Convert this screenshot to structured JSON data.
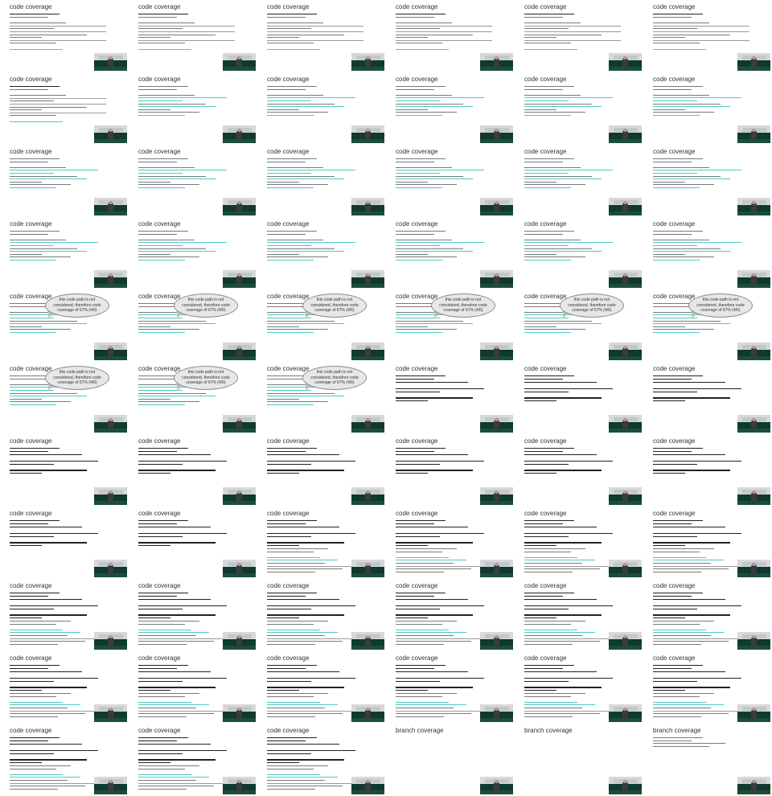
{
  "sheet": {
    "columns": 6,
    "rows": 11,
    "frame_count": 63
  },
  "bubble_text": "this code path is not considered, therefore code coverage of 67% (4/6)",
  "frames": [
    {
      "title": "code coverage",
      "variant": "terminal_report"
    },
    {
      "title": "code coverage",
      "variant": "terminal_report"
    },
    {
      "title": "code coverage",
      "variant": "terminal_report"
    },
    {
      "title": "code coverage",
      "variant": "terminal_report"
    },
    {
      "title": "code coverage",
      "variant": "terminal_report"
    },
    {
      "title": "code coverage",
      "variant": "terminal_report"
    },
    {
      "title": "code coverage",
      "variant": "terminal_report"
    },
    {
      "title": "code coverage",
      "variant": "source_colored"
    },
    {
      "title": "code coverage",
      "variant": "source_colored"
    },
    {
      "title": "code coverage",
      "variant": "source_colored"
    },
    {
      "title": "code coverage",
      "variant": "source_colored"
    },
    {
      "title": "code coverage",
      "variant": "source_colored"
    },
    {
      "title": "code coverage",
      "variant": "source_colored"
    },
    {
      "title": "code coverage",
      "variant": "source_colored"
    },
    {
      "title": "code coverage",
      "variant": "source_colored"
    },
    {
      "title": "code coverage",
      "variant": "source_colored"
    },
    {
      "title": "code coverage",
      "variant": "source_colored"
    },
    {
      "title": "code coverage",
      "variant": "source_colored"
    },
    {
      "title": "code coverage",
      "variant": "source_colored"
    },
    {
      "title": "code coverage",
      "variant": "source_colored"
    },
    {
      "title": "code coverage",
      "variant": "source_colored"
    },
    {
      "title": "code coverage",
      "variant": "source_colored"
    },
    {
      "title": "code coverage",
      "variant": "source_colored"
    },
    {
      "title": "code coverage",
      "variant": "source_colored"
    },
    {
      "title": "code coverage",
      "variant": "source_bubble"
    },
    {
      "title": "code coverage",
      "variant": "source_bubble"
    },
    {
      "title": "code coverage",
      "variant": "source_bubble"
    },
    {
      "title": "code coverage",
      "variant": "source_bubble"
    },
    {
      "title": "code coverage",
      "variant": "source_bubble"
    },
    {
      "title": "code coverage",
      "variant": "source_bubble"
    },
    {
      "title": "code coverage",
      "variant": "source_bubble"
    },
    {
      "title": "code coverage",
      "variant": "source_bubble"
    },
    {
      "title": "code coverage",
      "variant": "source_bubble"
    },
    {
      "title": "code coverage",
      "variant": "test_file"
    },
    {
      "title": "code coverage",
      "variant": "test_file"
    },
    {
      "title": "code coverage",
      "variant": "test_file"
    },
    {
      "title": "code coverage",
      "variant": "test_file"
    },
    {
      "title": "code coverage",
      "variant": "test_file"
    },
    {
      "title": "code coverage",
      "variant": "test_file"
    },
    {
      "title": "code coverage",
      "variant": "test_file"
    },
    {
      "title": "code coverage",
      "variant": "test_file"
    },
    {
      "title": "code coverage",
      "variant": "test_file"
    },
    {
      "title": "code coverage",
      "variant": "test_file"
    },
    {
      "title": "code coverage",
      "variant": "test_file"
    },
    {
      "title": "code coverage",
      "variant": "test_file_report"
    },
    {
      "title": "code coverage",
      "variant": "test_file_report"
    },
    {
      "title": "code coverage",
      "variant": "test_file_report"
    },
    {
      "title": "code coverage",
      "variant": "test_file_report"
    },
    {
      "title": "code coverage",
      "variant": "test_file_report"
    },
    {
      "title": "code coverage",
      "variant": "test_file_report"
    },
    {
      "title": "code coverage",
      "variant": "test_file_report"
    },
    {
      "title": "code coverage",
      "variant": "test_file_report"
    },
    {
      "title": "code coverage",
      "variant": "test_file_report"
    },
    {
      "title": "code coverage",
      "variant": "test_file_report"
    },
    {
      "title": "code coverage",
      "variant": "test_file_report"
    },
    {
      "title": "code coverage",
      "variant": "test_file_report"
    },
    {
      "title": "code coverage",
      "variant": "test_file_report"
    },
    {
      "title": "code coverage",
      "variant": "test_file_report"
    },
    {
      "title": "code coverage",
      "variant": "test_file_report"
    },
    {
      "title": "code coverage",
      "variant": "test_file_report"
    },
    {
      "title": "code coverage",
      "variant": "test_file_report"
    },
    {
      "title": "code coverage",
      "variant": "test_file_report"
    },
    {
      "title": "code coverage",
      "variant": "test_file_report"
    },
    {
      "title": "branch coverage",
      "variant": "blank"
    },
    {
      "title": "branch coverage",
      "variant": "blank"
    },
    {
      "title": "branch coverage",
      "variant": "branch_code"
    }
  ],
  "colors": {
    "title": "#333333",
    "code_green": "#4dc9c0",
    "code_gray": "#7a7a7a",
    "code_dark": "#222222",
    "bubble_fill": "#e7e7e7",
    "video_floor": "#0f3a2c"
  }
}
